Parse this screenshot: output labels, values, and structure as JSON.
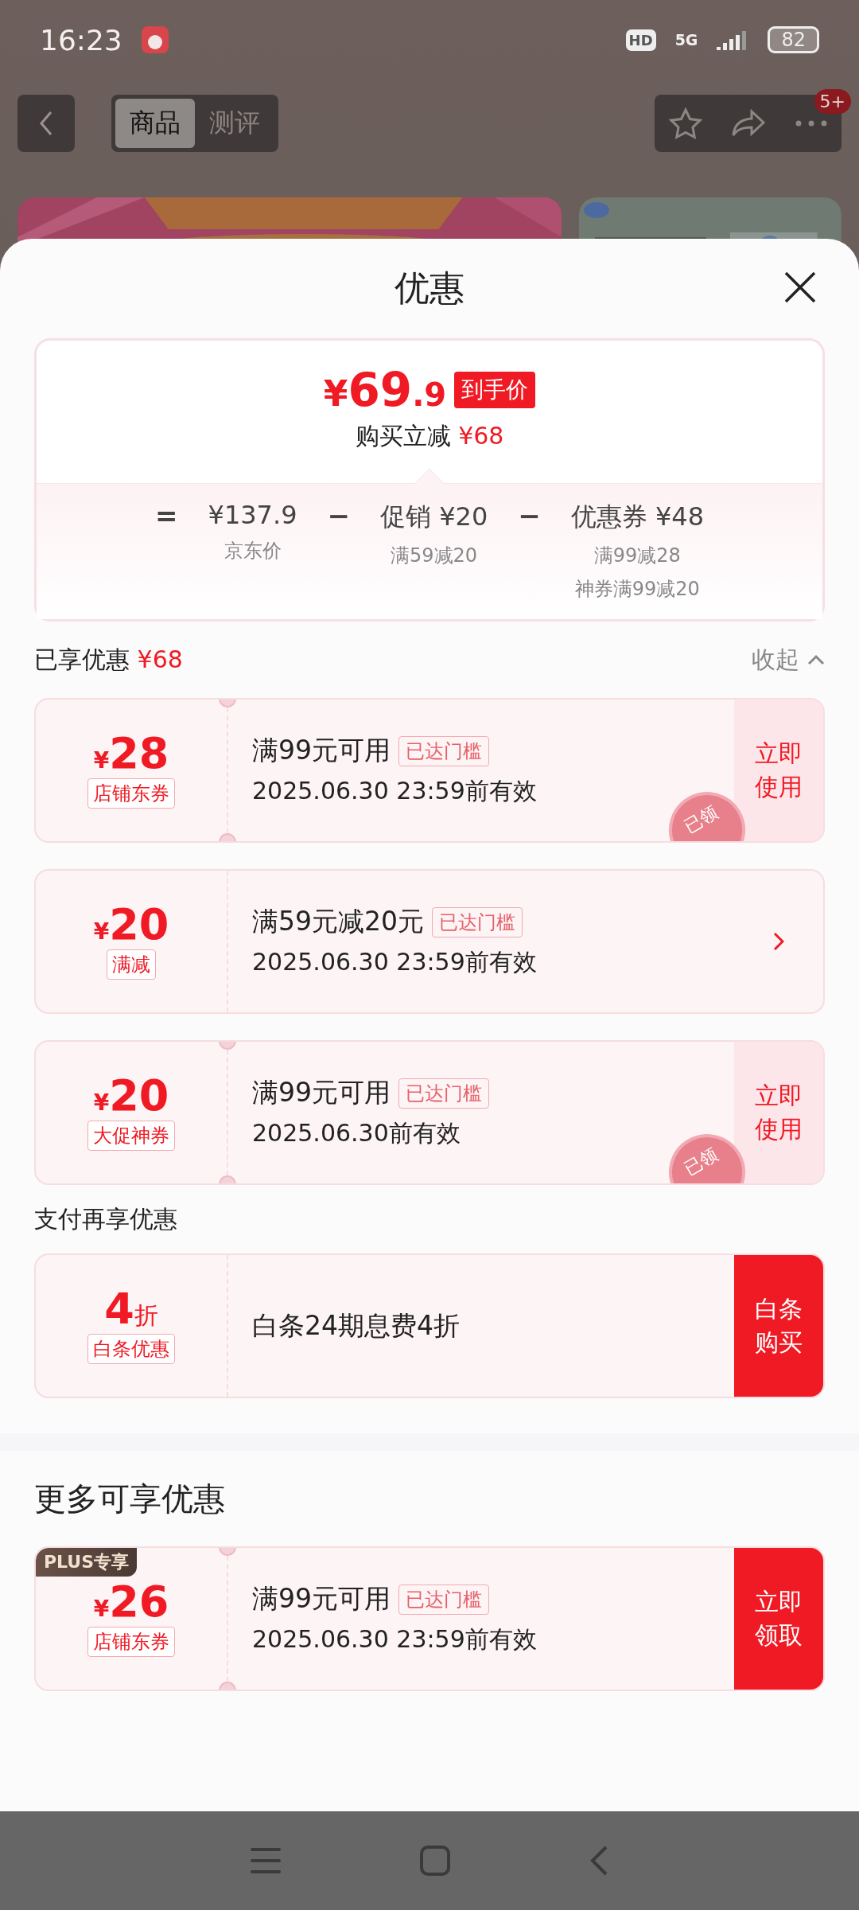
{
  "status_bar": {
    "time": "16:23",
    "hd": "HD",
    "network": "5G",
    "battery": "82"
  },
  "nav": {
    "tabs": [
      {
        "label": "商品",
        "selected": true
      },
      {
        "label": "测评",
        "selected": false
      }
    ],
    "badge": "5+"
  },
  "sheet": {
    "title": "优惠"
  },
  "price_summary": {
    "currency": "¥",
    "price_int": "69",
    "price_dec": ".9",
    "price_tag": "到手价",
    "saving_label": "购买立减",
    "saving": "¥68",
    "formula": [
      {
        "kind": "op",
        "text": "="
      },
      {
        "kind": "term",
        "value": "¥137.9",
        "notes": [
          "京东价"
        ]
      },
      {
        "kind": "op",
        "text": "−"
      },
      {
        "kind": "term",
        "label": "促销",
        "value": "¥20",
        "notes": [
          "满59减20"
        ]
      },
      {
        "kind": "op",
        "text": "−"
      },
      {
        "kind": "term",
        "label": "优惠券",
        "value": "¥48",
        "notes": [
          "满99减28",
          "神券满99减20"
        ]
      }
    ]
  },
  "applied": {
    "title": "已享优惠",
    "amount": "¥68",
    "toggle": "收起",
    "expanded": true,
    "coupons": [
      {
        "currency": "¥",
        "amount": "28",
        "type_tag": "店铺东券",
        "condition": "满99元可用",
        "badge": "已达门槛",
        "validity": "2025.06.30 23:59前有效",
        "notched": true,
        "stamp": "已领",
        "action": {
          "kind": "soft",
          "label": "立即使用"
        }
      },
      {
        "currency": "¥",
        "amount": "20",
        "type_tag": "满减",
        "condition": "满59元减20元",
        "badge": "已达门槛",
        "validity": "2025.06.30 23:59前有效",
        "notched": false,
        "action": {
          "kind": "chevron"
        }
      },
      {
        "currency": "¥",
        "amount": "20",
        "type_tag": "大促神券",
        "condition": "满99元可用",
        "badge": "已达门槛",
        "validity": "2025.06.30前有效",
        "notched": true,
        "stamp": "已领",
        "action": {
          "kind": "soft",
          "label": "立即使用"
        }
      }
    ]
  },
  "payment": {
    "title": "支付再享优惠",
    "coupons": [
      {
        "amount": "4",
        "unit": "折",
        "type_tag": "白条优惠",
        "condition": "白条24期息费4折",
        "notched": false,
        "action": {
          "kind": "solid",
          "label": "白条购买"
        }
      }
    ]
  },
  "more": {
    "title": "更多可享优惠",
    "coupons": [
      {
        "ribbon": "PLUS专享",
        "currency": "¥",
        "amount": "26",
        "type_tag": "店铺东券",
        "condition": "满99元可用",
        "badge": "已达门槛",
        "validity": "2025.06.30 23:59前有效",
        "notched": true,
        "action": {
          "kind": "solid",
          "label": "立即领取"
        }
      }
    ]
  }
}
